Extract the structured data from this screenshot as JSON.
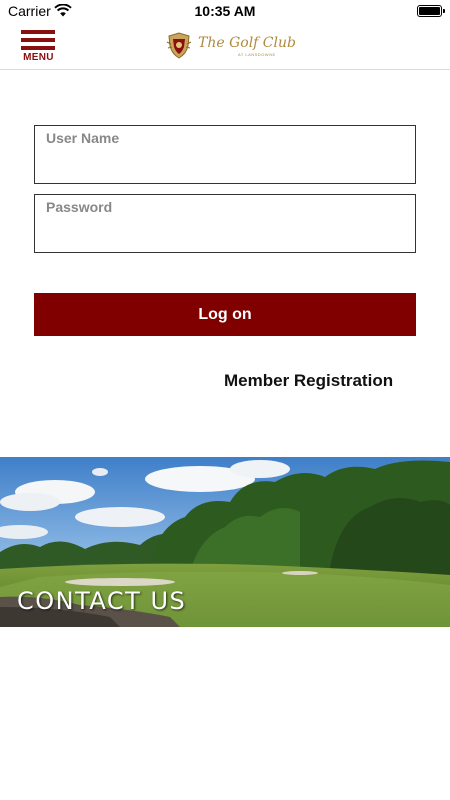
{
  "status_bar": {
    "carrier": "Carrier",
    "time": "10:35 AM"
  },
  "header": {
    "menu_label": "MENU",
    "logo_text": "The Golf Club",
    "logo_subtext": "AT LANSDOWNE"
  },
  "login": {
    "username_placeholder": "User Name",
    "password_placeholder": "Password",
    "logon_label": "Log on",
    "member_registration_label": "Member Registration"
  },
  "banner": {
    "label": "CONTACT US"
  },
  "colors": {
    "brand": "#800000",
    "menu": "#8a1010",
    "logo_gold": "#b08a3e"
  },
  "icons": {
    "wifi": "wifi-icon",
    "battery": "battery-icon",
    "menu": "hamburger-icon",
    "crest": "crest-icon"
  }
}
